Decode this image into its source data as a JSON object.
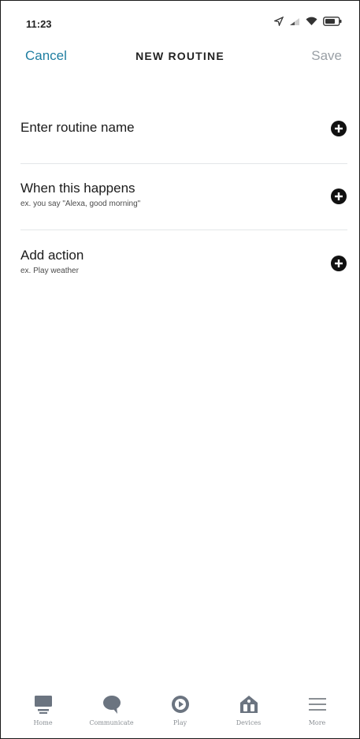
{
  "status_bar": {
    "time": "11:23",
    "icons": [
      "location-arrow-icon",
      "signal-icon",
      "wifi-icon",
      "battery-icon"
    ]
  },
  "header": {
    "cancel_label": "Cancel",
    "title": "NEW ROUTINE",
    "save_label": "Save"
  },
  "rows": [
    {
      "title": "Enter routine name",
      "subtitle": ""
    },
    {
      "title": "When this happens",
      "subtitle": "ex. you say \"Alexa, good morning\""
    },
    {
      "title": "Add action",
      "subtitle": "ex. Play weather"
    }
  ],
  "bottom_nav": {
    "items": [
      {
        "label": "Home",
        "icon": "home-icon"
      },
      {
        "label": "Communicate",
        "icon": "chat-bubble-icon"
      },
      {
        "label": "Play",
        "icon": "play-icon"
      },
      {
        "label": "Devices",
        "icon": "devices-icon"
      },
      {
        "label": "More",
        "icon": "menu-icon"
      }
    ]
  },
  "colors": {
    "accent": "#1f7ea1",
    "disabled": "#9aa0a6",
    "nav_icon": "#6b7480",
    "divider": "#e3e6e8"
  }
}
